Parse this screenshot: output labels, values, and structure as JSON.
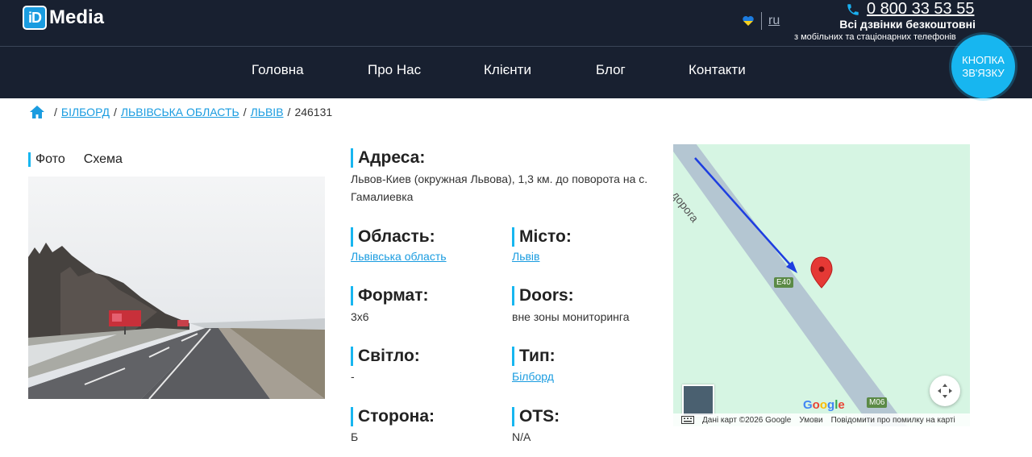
{
  "header": {
    "logo_mark": "iD",
    "logo_text": "Media",
    "lang": "ru",
    "phone": "0 800 33 53 55",
    "free_calls": "Всі дзвінки безкоштовні",
    "free_calls_sub": "з мобільних та стаціонарних телефонів"
  },
  "nav": {
    "items": [
      "Головна",
      "Про Нас",
      "Клієнти",
      "Блог",
      "Контакти"
    ]
  },
  "call_button": {
    "line1": "КНОПКА",
    "line2": "ЗВ'ЯЗКУ"
  },
  "breadcrumb": {
    "items": [
      "БІЛБОРД",
      "ЛЬВІВСЬКА ОБЛАСТЬ",
      "ЛЬВІВ"
    ],
    "current": "246131"
  },
  "photo_tabs": [
    "Фото",
    "Схема"
  ],
  "details": {
    "address_label": "Адреса:",
    "address_value": "Львов-Киев (окружная Львова), 1,3 км. до поворота на с. Гамалиевка",
    "region_label": "Область:",
    "region_value": "Львівська область",
    "city_label": "Місто:",
    "city_value": "Львів",
    "format_label": "Формат:",
    "format_value": "3x6",
    "doors_label": "Doors:",
    "doors_value": "вне зоны мониторинга",
    "light_label": "Світло:",
    "light_value": "-",
    "type_label": "Тип:",
    "type_value": "Білборд",
    "side_label": "Сторона:",
    "side_value": "Б",
    "ots_label": "OTS:",
    "ots_value": "N/A"
  },
  "map": {
    "road_name": "ва дорога",
    "road_badge_1": "E40",
    "road_badge_2": "M06",
    "google": "Google",
    "footer_data": "Дані карт ©2026 Google",
    "footer_terms": "Умови",
    "footer_report": "Повідомити про помилку на карті",
    "colors": {
      "land": "#d6f5e3",
      "road": "#b4c6d2",
      "badge": "#5b8a46",
      "marker": "#e53935",
      "arrow": "#1e3ee0"
    }
  }
}
